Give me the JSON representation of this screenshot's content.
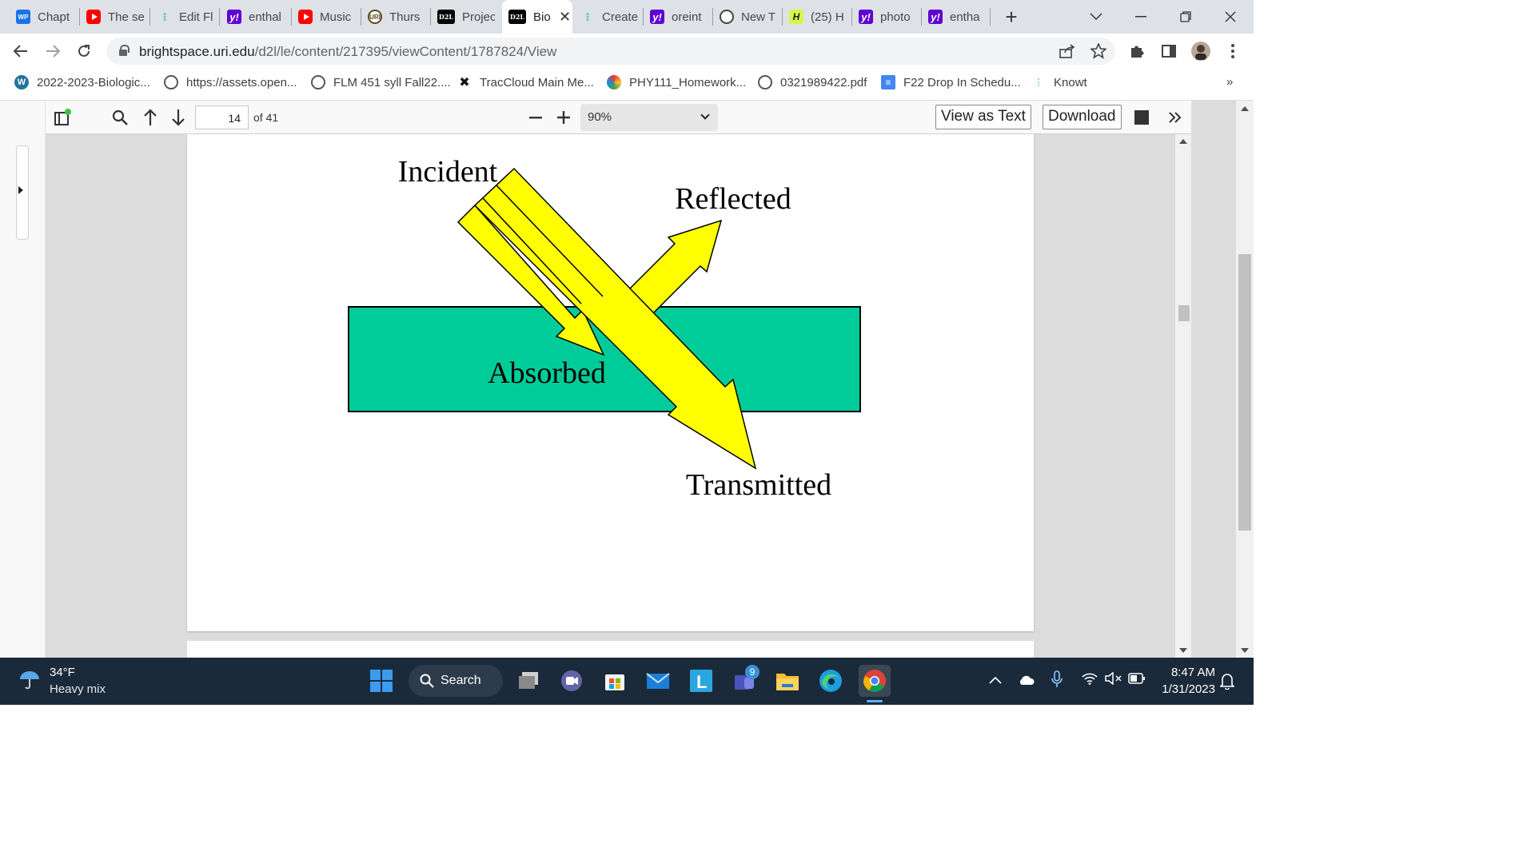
{
  "browser": {
    "tabs": [
      {
        "label": "Chapt",
        "icon": "wordpress-icon"
      },
      {
        "label": "The se",
        "icon": "youtube-icon"
      },
      {
        "label": "Edit Fl",
        "icon": "knowt-icon"
      },
      {
        "label": "enthal",
        "icon": "yahoo-icon"
      },
      {
        "label": "Music",
        "icon": "youtube-icon"
      },
      {
        "label": "Thurs",
        "icon": "uri-icon"
      },
      {
        "label": "Projec",
        "icon": "d2l-icon"
      },
      {
        "label": "Bio",
        "icon": "d2l-icon",
        "active": true
      },
      {
        "label": "Create",
        "icon": "knowt-icon"
      },
      {
        "label": "oreint",
        "icon": "yahoo-icon"
      },
      {
        "label": "New T",
        "icon": "globe-icon"
      },
      {
        "label": "(25) H",
        "icon": "h-icon"
      },
      {
        "label": "photo",
        "icon": "yahoo-icon"
      },
      {
        "label": "entha",
        "icon": "yahoo-icon"
      }
    ],
    "url_host": "brightspace.uri.edu",
    "url_path": "/d2l/le/content/217395/viewContent/1787824/View",
    "bookmarks": [
      {
        "label": "2022-2023-Biologic...",
        "icon": "wordpress-icon"
      },
      {
        "label": "https://assets.open...",
        "icon": "globe-icon"
      },
      {
        "label": "FLM 451 syll Fall22....",
        "icon": "globe-icon"
      },
      {
        "label": "TracCloud Main Me...",
        "icon": "traccloud-icon"
      },
      {
        "label": "PHY111_Homework...",
        "icon": "colorful-icon"
      },
      {
        "label": "0321989422.pdf",
        "icon": "globe-icon"
      },
      {
        "label": "F22 Drop In Schedu...",
        "icon": "docs-icon"
      },
      {
        "label": "Knowt",
        "icon": "knowt-icon"
      }
    ],
    "bookmarks_overflow": "»"
  },
  "pdf_viewer": {
    "page_current": "14",
    "page_total": "of 41",
    "zoom": "90%",
    "view_as_text": "View as Text",
    "download": "Download"
  },
  "diagram": {
    "labels": {
      "incident": "Incident",
      "reflected": "Reflected",
      "absorbed": "Absorbed",
      "transmitted": "Transmitted"
    },
    "colors": {
      "arrow_fill": "#FFFF00",
      "medium_fill": "#00CC99",
      "stroke": "#000000"
    }
  },
  "taskbar": {
    "weather_temp": "34°F",
    "weather_desc": "Heavy mix",
    "search_label": "Search",
    "teams_badge": "9",
    "time": "8:47 AM",
    "date": "1/31/2023"
  }
}
